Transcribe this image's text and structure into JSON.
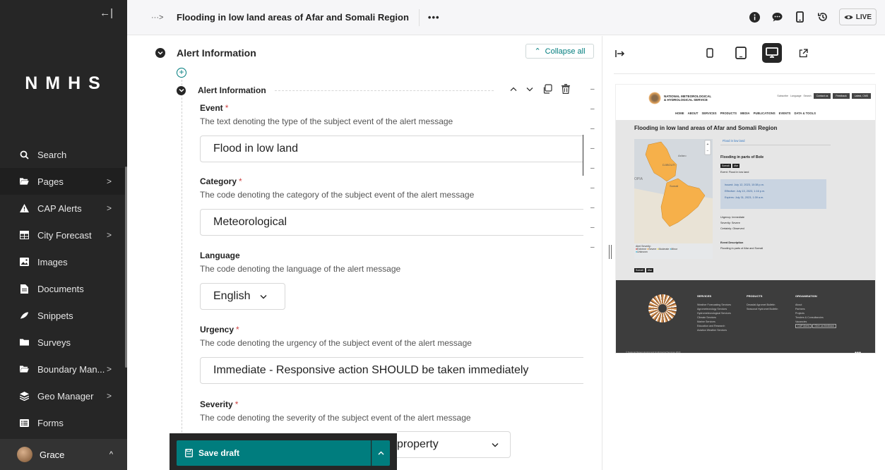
{
  "sidebar": {
    "collapse_glyph": "←|",
    "logo": "NMHS",
    "items": [
      {
        "label": "Search",
        "icon": "search-icon"
      },
      {
        "label": "Pages",
        "icon": "folder-open-icon",
        "has_children": true
      },
      {
        "label": "CAP Alerts",
        "icon": "warning-icon",
        "has_children": true
      },
      {
        "label": "City Forecast",
        "icon": "table-icon",
        "has_children": true
      },
      {
        "label": "Images",
        "icon": "image-icon"
      },
      {
        "label": "Documents",
        "icon": "document-icon"
      },
      {
        "label": "Snippets",
        "icon": "snippet-icon"
      },
      {
        "label": "Surveys",
        "icon": "folder-icon"
      },
      {
        "label": "Boundary Man...",
        "icon": "folder-open-icon",
        "has_children": true
      },
      {
        "label": "Geo Manager",
        "icon": "layers-icon",
        "has_children": true
      },
      {
        "label": "Forms",
        "icon": "list-icon"
      }
    ],
    "account_name": "Grace"
  },
  "header": {
    "breadcrumb_toggle": "···>",
    "title": "Flooding in low land areas of Afar and Somali Region",
    "more": "•••",
    "live_label": "LIVE"
  },
  "form": {
    "section_title": "Alert Information",
    "collapse_all_label": "Collapse all",
    "block_title": "Alert Information",
    "fields": {
      "event": {
        "label": "Event",
        "required": true,
        "help": "The text denoting the type of the subject event of the alert message",
        "value": "Flood in low land"
      },
      "category": {
        "label": "Category",
        "required": true,
        "help": "The code denoting the category of the subject event of the alert message",
        "value": "Meteorological"
      },
      "language": {
        "label": "Language",
        "required": false,
        "help": "The code denoting the language of the alert message",
        "value": "English"
      },
      "urgency": {
        "label": "Urgency",
        "required": true,
        "help": "The code denoting the urgency of the subject event of the alert message",
        "value": "Immediate - Responsive action SHOULD be taken immediately"
      },
      "severity": {
        "label": "Severity",
        "required": true,
        "help": "The code denoting the severity of the subject event of the alert message",
        "value_visible": "property"
      }
    },
    "required_mark": "*"
  },
  "savebar": {
    "save_label": "Save draft"
  },
  "preview": {
    "site": {
      "org_name_line1": "NATIONAL METEOROLOGICAL",
      "org_name_line2": "& HYDROLOGICAL SERVICE",
      "top_links": [
        "Subscribe",
        "Language",
        "Search"
      ],
      "top_buttons": [
        "Contact us",
        "Feedback",
        "Latest, CMS"
      ],
      "nav": [
        "HOME",
        "ABOUT",
        "SERVICES",
        "PRODUCTS",
        "MEDIA",
        "PUBLICATIONS",
        "EVENTS",
        "DATA & TOOLS"
      ],
      "alert_title": "Flooding in low land areas of Afar and Somali Region",
      "tab_label": "Flood in low land",
      "area_title": "Flooding in parts of Bole",
      "pills": [
        "Somali",
        "Afar"
      ],
      "event_line": "Event:   Flood in low land",
      "issued": "Issued: July 12, 2023, 10:38 p.m.",
      "effective": "Effective: July 13, 2023, 1:16 p.m.",
      "expires": "Expires: July 31, 2023, 1:39 a.m.",
      "urgency": "Urgency: Immediate",
      "severity": "Severity: Severe",
      "certainty": "Certainty: Observed",
      "event_desc_title": "Event Description",
      "event_desc": "Flooding in parts of Afar and Somali",
      "legend_title": "Alert Severity:",
      "legend_items": [
        "Extreme",
        "Severe",
        "Moderate",
        "Minor",
        "Unknown"
      ],
      "map_labels": [
        "Asfaro",
        "DJIBOUTI",
        "OPIA",
        "Somali"
      ],
      "footer_cols": {
        "services": {
          "title": "SERVICES",
          "items": [
            "Weather Forecasting Services",
            "Agrometeorology Services",
            "Hydrometeorological Services",
            "Climate Services",
            "Marine Services",
            "Education and Research",
            "Aviation Weather Services"
          ]
        },
        "products": {
          "title": "PRODUCTS",
          "items": [
            "Decadal Agromet Bulletin",
            "Seasonal Hydromet Bulletin"
          ]
        },
        "organisation": {
          "title": "ORGANISATION",
          "items": [
            "About",
            "Partners",
            "Projects",
            "Tenders & Consultancies",
            "Vacancies"
          ],
          "buttons": [
            "CAP Alerts",
            "Give us feedback"
          ]
        }
      },
      "copyright": "© National Meteorological and Hydrological Services 2023"
    }
  },
  "colors": {
    "sidebar_bg": "#262626",
    "accent_teal": "#007d7e",
    "required_red": "#cd4444",
    "map_alert": "#f6b04a"
  }
}
